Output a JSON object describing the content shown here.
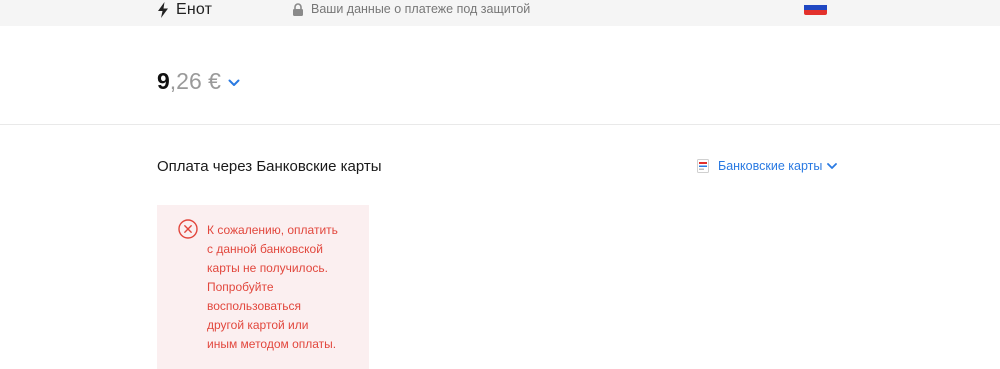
{
  "header": {
    "brand_name": "Енот",
    "secure_text": "Ваши данные о платеже под защитой",
    "icons": [
      "bolt-icon",
      "lock-icon",
      "russia-flag-icon"
    ]
  },
  "amount": {
    "integer": "9",
    "fraction": ",26 €",
    "icon": "chevron-down-icon"
  },
  "payment": {
    "title": "Оплата через Банковские карты",
    "method_label": "Банковские карты",
    "icons": [
      "bank-card-icon",
      "chevron-down-icon"
    ]
  },
  "error": {
    "icon": "close-circle-icon",
    "lines": [
      "К сожалению, оплатить",
      "с данной банковской",
      "карты не получилось.",
      "Попробуйте",
      "воспользоваться",
      "другой картой или",
      "иным методом оплаты."
    ]
  },
  "colors": {
    "accent": "#2a7ae2",
    "error_text": "#e2473d",
    "error_bg": "#fbeff0",
    "topbar_bg": "#f5f5f5"
  }
}
